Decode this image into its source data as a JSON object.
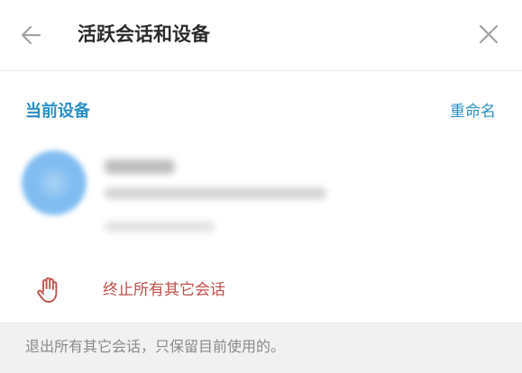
{
  "header": {
    "title": "活跃会话和设备",
    "back_icon": "back-arrow-icon",
    "close_icon": "close-icon"
  },
  "current_device": {
    "section_title": "当前设备",
    "rename_label": "重命名",
    "avatar_color": "#7dbaf0"
  },
  "actions": {
    "terminate_label": "终止所有其它会话",
    "terminate_icon": "hand-stop-icon",
    "terminate_color": "#c0504d"
  },
  "footer": {
    "note": "退出所有其它会话，只保留目前使用的。"
  },
  "colors": {
    "accent": "#2a8fc4",
    "footer_bg": "#f1f1f1"
  }
}
